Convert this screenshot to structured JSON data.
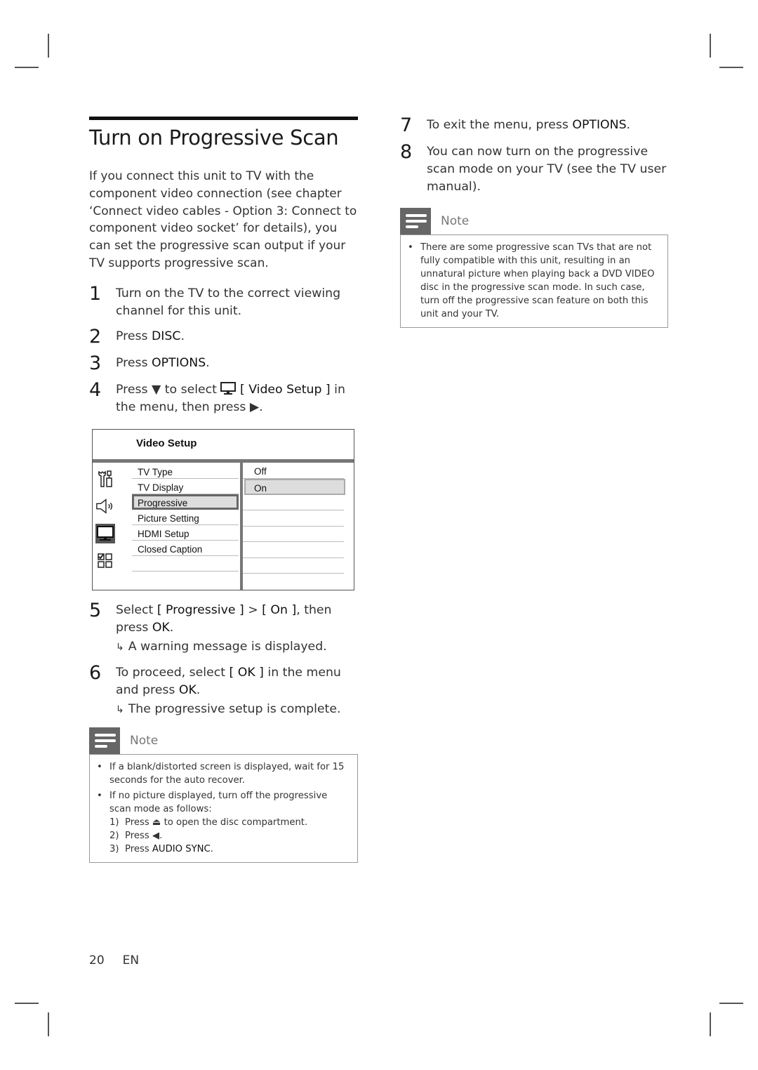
{
  "title": "Turn on Progressive Scan",
  "intro": "If you connect this unit to TV with the component video connection (see chapter ‘Connect video cables - Option 3: Connect to component video socket’ for details), you can set the progressive scan output if your TV supports progressive scan.",
  "steps": [
    {
      "num": "1",
      "text": "Turn on the TV to the correct viewing channel for this unit."
    },
    {
      "num": "2",
      "pre": "Press ",
      "kw": "DISC",
      "post": "."
    },
    {
      "num": "3",
      "pre": "Press ",
      "kw": "OPTIONS",
      "post": "."
    },
    {
      "num": "4",
      "pre": "Press ",
      "down": "▼",
      "mid": " to select ",
      "kw": "[ Video Setup ]",
      "post": " in the menu, then press ",
      "right": "▶",
      "end": "."
    },
    {
      "num": "5",
      "pre": "Select ",
      "kw": "[ Progressive ]",
      "mid": " > ",
      "kw2": "[ On ]",
      "post": ", then press ",
      "kw3": "OK",
      "end": ".",
      "result": "A warning message is displayed."
    },
    {
      "num": "6",
      "pre": "To proceed, select ",
      "kw": "[ OK ]",
      "post": " in the menu and press ",
      "kw2": "OK",
      "end": ".",
      "result": "The progressive setup is complete."
    },
    {
      "num": "7",
      "pre": "To exit the menu, press ",
      "kw": "OPTIONS",
      "post": "."
    },
    {
      "num": "8",
      "text": "You can now turn on the progressive scan mode on your TV (see the TV user manual)."
    }
  ],
  "menu": {
    "title": "Video Setup",
    "icons": [
      "tools-icon",
      "speaker-icon",
      "tv-monitor-icon",
      "preferences-grid-icon"
    ],
    "options": [
      "TV Type",
      "TV Display",
      "Progressive",
      "Picture Setting",
      "HDMI Setup",
      "Closed Caption",
      ""
    ],
    "selected_option": "Progressive",
    "values": [
      "Off",
      "On",
      "",
      "",
      "",
      "",
      ""
    ],
    "selected_value": "On"
  },
  "note_left": {
    "label": "Note",
    "bullets": [
      "If a blank/distorted screen is displayed, wait for 15 seconds for the auto recover.",
      "If no picture displayed, turn off the progressive scan mode as follows:"
    ],
    "substeps": [
      {
        "n": "1)",
        "pre": "Press ",
        "sym": "⏏",
        "post": " to open the disc compartment."
      },
      {
        "n": "2)",
        "pre": "Press ",
        "sym": "◀",
        "post": "."
      },
      {
        "n": "3)",
        "pre": "Press ",
        "kw": "AUDIO SYNC",
        "post": "."
      }
    ]
  },
  "note_right": {
    "label": "Note",
    "bullets": [
      "There are some progressive scan TVs that are not fully compatible with this unit, resulting in an unnatural picture when playing back a DVD VIDEO disc in the progressive scan mode. In such case, turn off the progressive scan feature on both this unit and your TV."
    ]
  },
  "footer": {
    "page": "20",
    "lang": "EN"
  },
  "bullet_char": "•",
  "result_arrow": "↳"
}
